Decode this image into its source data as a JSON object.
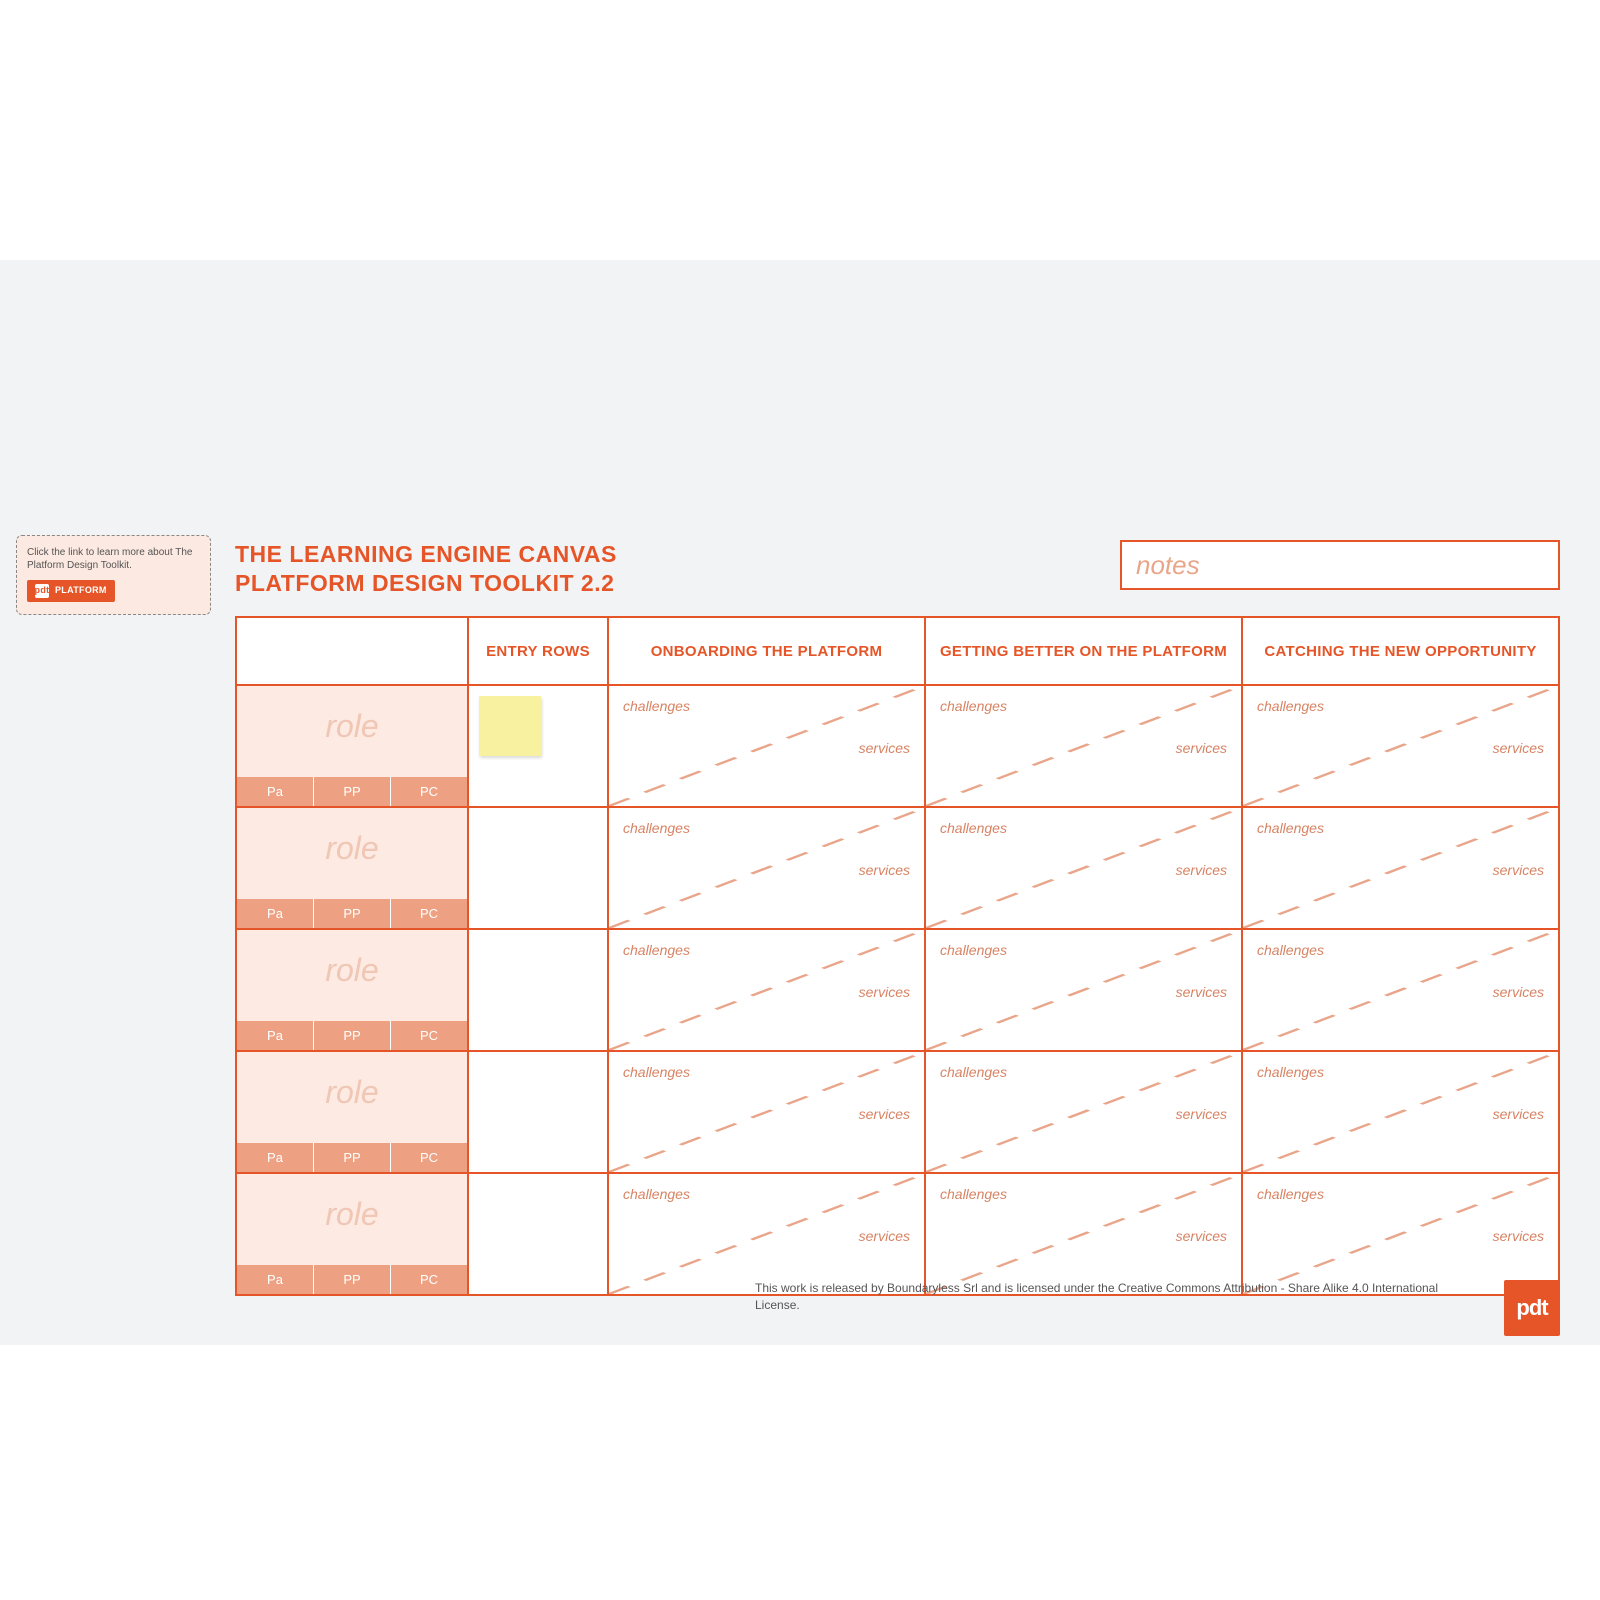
{
  "info": {
    "text": "Click the link to learn more about The Platform Design Toolkit.",
    "badge_icon": "pdt",
    "badge_text": "PLATFORM"
  },
  "title_line1": "THE LEARNING ENGINE CANVAS",
  "title_line2": "PLATFORM DESIGN TOOLKIT 2.2",
  "notes_placeholder": "notes",
  "columns": {
    "entry": "ENTRY ROWS",
    "c1": "ONBOARDING THE PLATFORM",
    "c2": "GETTING BETTER ON THE PLATFORM",
    "c3": "CATCHING THE NEW OPPORTUNITY"
  },
  "cell_labels": {
    "challenges": "challenges",
    "services": "services"
  },
  "role_label": "role",
  "role_tabs": [
    "Pa",
    "PP",
    "PC"
  ],
  "row_count": 5,
  "license": "This work is released by Boundaryless Srl and is licensed under the Creative Commons Attribution - Share Alike 4.0 International License.",
  "logo_text": "pdt"
}
